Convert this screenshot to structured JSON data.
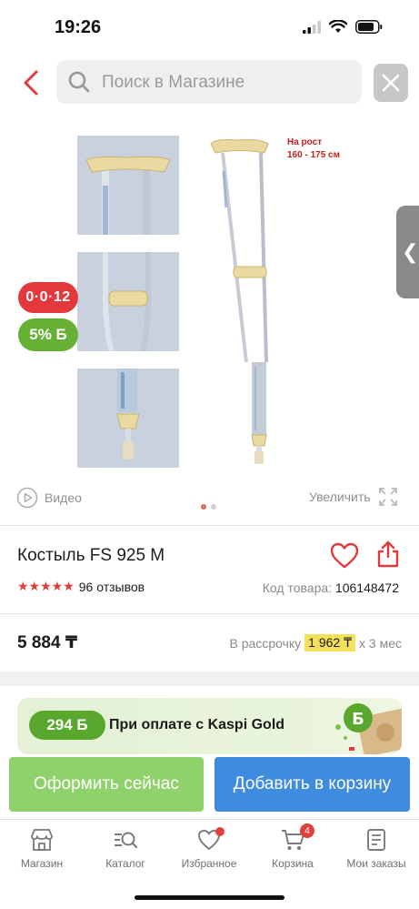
{
  "status_bar": {
    "time": "19:26"
  },
  "search": {
    "placeholder": "Поиск в Магазине"
  },
  "gallery": {
    "height_note_line1": "На рост",
    "height_note_line2": "160 - 175 см",
    "timer_badge": "0·0·12",
    "bonus_badge": "5% Б",
    "video_label": "Видео",
    "zoom_label": "Увеличить",
    "slides_total": 2,
    "active_slide": 1
  },
  "product": {
    "title": "Костыль FS 925 M",
    "rating_stars": 5,
    "reviews": "96 отзывов",
    "sku_label": "Код товара:",
    "sku_value": "106148472",
    "price": "5 884 ₸",
    "installment_label": "В рассрочку",
    "installment_amount": "1 962 ₸",
    "installment_term": "х 3 мес"
  },
  "kaspi_gold": {
    "bonus": "294 Б",
    "text": "При оплате с Kaspi Gold"
  },
  "actions": {
    "checkout_label": "Оформить сейчас",
    "cart_label": "Добавить в корзину"
  },
  "tabbar": {
    "items": [
      {
        "label": "Магазин",
        "icon": "store-icon"
      },
      {
        "label": "Каталог",
        "icon": "catalog-search-icon"
      },
      {
        "label": "Избранное",
        "icon": "heart-icon"
      },
      {
        "label": "Корзина",
        "icon": "cart-icon",
        "badge": "4"
      },
      {
        "label": "Мои заказы",
        "icon": "orders-icon"
      }
    ]
  },
  "colors": {
    "accent_red": "#e3393c",
    "bonus_green": "#66b135",
    "checkout_green": "#8fd16a",
    "cart_blue": "#3f8be0"
  }
}
